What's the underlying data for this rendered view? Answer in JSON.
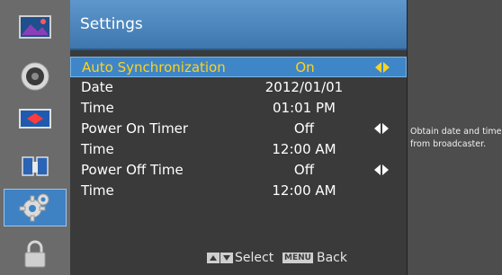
{
  "sidebar": {
    "items": [
      {
        "icon": "picture-icon",
        "active": false
      },
      {
        "icon": "sound-icon",
        "active": false
      },
      {
        "icon": "channel-icon",
        "active": false
      },
      {
        "icon": "features-icon",
        "active": false
      },
      {
        "icon": "gear-icon",
        "active": true
      },
      {
        "icon": "lock-icon",
        "active": false
      }
    ]
  },
  "header": {
    "title": "Settings"
  },
  "menu": {
    "rows": [
      {
        "label": "Auto Synchronization",
        "value": "On",
        "has_arrows": true,
        "selected": true
      },
      {
        "label": "Date",
        "value": "2012/01/01",
        "has_arrows": false,
        "selected": false
      },
      {
        "label": "Time",
        "value": "01:01 PM",
        "has_arrows": false,
        "selected": false
      },
      {
        "label": "Power On Timer",
        "value": "Off",
        "has_arrows": true,
        "selected": false
      },
      {
        "label": "Time",
        "value": "12:00 AM",
        "has_arrows": false,
        "selected": false
      },
      {
        "label": "Power Off Time",
        "value": "Off",
        "has_arrows": true,
        "selected": false
      },
      {
        "label": "Time",
        "value": "12:00 AM",
        "has_arrows": false,
        "selected": false
      }
    ]
  },
  "footer": {
    "select_label": "Select",
    "menu_key": "MENU",
    "back_label": "Back"
  },
  "help": {
    "text": "Obtain date and time from broadcaster."
  },
  "colors": {
    "accent": "#3f86c8",
    "highlight_text": "#ffd21a",
    "title_bar": "#4a86bf"
  }
}
